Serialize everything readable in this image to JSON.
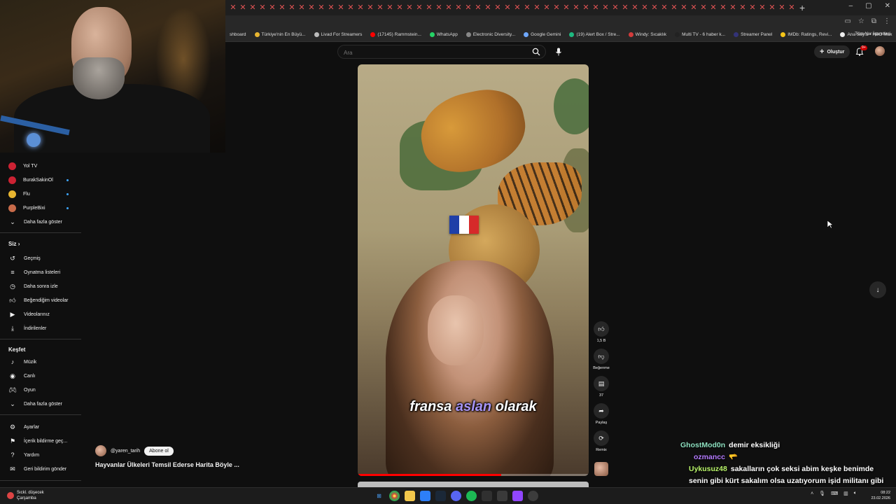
{
  "browser": {
    "bookmarks": [
      {
        "label": "shboard",
        "color": ""
      },
      {
        "label": "Türkiye'nin En Büyü...",
        "color": "#e8b530"
      },
      {
        "label": "Livad For Streamers",
        "color": "#bbbbbb"
      },
      {
        "label": "(17145) Rammstein...",
        "color": "#ff0000"
      },
      {
        "label": "WhatsApp",
        "color": "#25d366"
      },
      {
        "label": "Electronic Diversity...",
        "color": "#888888"
      },
      {
        "label": "Google Gemini",
        "color": "#6fa8ff"
      },
      {
        "label": "(19) Alert Box / Stre...",
        "color": "#1eb980"
      },
      {
        "label": "Windy: Sıcaklık",
        "color": "#d23b3b"
      },
      {
        "label": "Multi TV - 6 haber k...",
        "color": "#222222"
      },
      {
        "label": "Streamer Panel",
        "color": "#333377"
      },
      {
        "label": "IMDb: Ratings, Revi...",
        "color": "#f5c518"
      },
      {
        "label": "Ana Sayfa • HBO Max",
        "color": "#eeeeee"
      }
    ],
    "all_bookmarks": "Tüm Yer İşaretleri"
  },
  "header": {
    "search_placeholder": "Ara",
    "create_label": "Oluştur",
    "notif_badge": "9+"
  },
  "sidebar": {
    "subscriptions": [
      {
        "label": "Yol TV",
        "color": "#cc2233",
        "live": false
      },
      {
        "label": "BurakSakinOl",
        "color": "#cc2233",
        "live": true
      },
      {
        "label": "Flu",
        "color": "#e8b530",
        "live": true
      },
      {
        "label": "PurpleBixi",
        "color": "#c86b4a",
        "live": true
      }
    ],
    "show_more": "Daha fazla göster",
    "you_heading": "Siz",
    "you_items": [
      {
        "label": "Geçmiş",
        "icon": "history-icon"
      },
      {
        "label": "Oynatma listeleri",
        "icon": "playlist-icon"
      },
      {
        "label": "Daha sonra izle",
        "icon": "clock-icon"
      },
      {
        "label": "Beğendiğim videolar",
        "icon": "like-icon"
      },
      {
        "label": "Videolarınız",
        "icon": "video-icon"
      },
      {
        "label": "İndirilenler",
        "icon": "download-icon"
      }
    ],
    "explore_heading": "Keşfet",
    "explore_items": [
      {
        "label": "Müzik",
        "icon": "music-icon"
      },
      {
        "label": "Canlı",
        "icon": "live-icon"
      },
      {
        "label": "Oyun",
        "icon": "gamepad-icon"
      }
    ],
    "show_more_2": "Daha fazla göster",
    "bottom_items": [
      {
        "label": "Ayarlar",
        "icon": "gear-icon"
      },
      {
        "label": "İçerik bildirme geç...",
        "icon": "flag-icon"
      },
      {
        "label": "Yardım",
        "icon": "help-icon"
      },
      {
        "label": "Geri bildirim gönder",
        "icon": "feedback-icon"
      }
    ]
  },
  "video": {
    "subtitle_pre": "fransa",
    "subtitle_hl": "aslan",
    "subtitle_post": "olarak",
    "channel": "@yaren_tarih",
    "subscribe": "Abone ol",
    "title": "Hayvanlar Ülkeleri Temsil Ederse Harita Böyle ...",
    "progress": 0.62,
    "likes": "1,5 B",
    "dislike_label": "Beğenme",
    "comments": "37",
    "share_label": "Paylaş",
    "remix_label": "Remix",
    "flag_colors": [
      "#1f3fa8",
      "#ffffff",
      "#d62a2a"
    ]
  },
  "chat": [
    {
      "user": "GhostMod0n",
      "color": "#8ee0c0",
      "text": "demir eksikliği"
    },
    {
      "user": "ozmancc",
      "color": "#b57bff",
      "text": "🫳"
    },
    {
      "user": "Uykusuz48",
      "color": "#b9f56a",
      "text": "sakalların çok seksi abim keşke benimde senin gibi kürt sakalım olsa uzatıyorum işid militanı gibi geziyorum"
    }
  ],
  "taskbar": {
    "weather_line1": "Sıckl. düşecek",
    "weather_line2": "Çarşamba",
    "time": "08:22",
    "date": "23.02.2026"
  }
}
